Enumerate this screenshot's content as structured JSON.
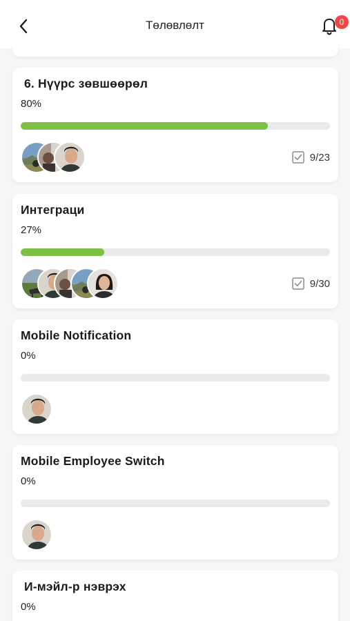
{
  "header": {
    "title": "Төлөвлөлт",
    "notification_count": "0"
  },
  "colors": {
    "progress_fill": "#7cc144",
    "progress_track": "#e9eaec",
    "badge": "#ef4747"
  },
  "cards": [
    {
      "title": "6. Нүүрс зөвшөөрөл",
      "percent_label": "80%",
      "progress": 0.8,
      "tasks": "9/23",
      "avatars": [
        "landscape-photo",
        "mixed-photo",
        "person-photo"
      ]
    },
    {
      "title": "Интеграци",
      "percent_label": "27%",
      "progress": 0.27,
      "tasks": "9/30",
      "avatars": [
        "horse-photo",
        "person-photo",
        "mixed-photo",
        "landscape-photo",
        "woman-photo"
      ]
    },
    {
      "title": "Mobile Notification",
      "percent_label": "0%",
      "progress": 0,
      "avatars": [
        "person-photo"
      ]
    },
    {
      "title": "Mobile Employee Switch",
      "percent_label": "0%",
      "progress": 0,
      "avatars": [
        "person-photo"
      ]
    },
    {
      "title": "И-мэйл-р нэврэх",
      "percent_label": "0%",
      "progress": 0
    }
  ]
}
